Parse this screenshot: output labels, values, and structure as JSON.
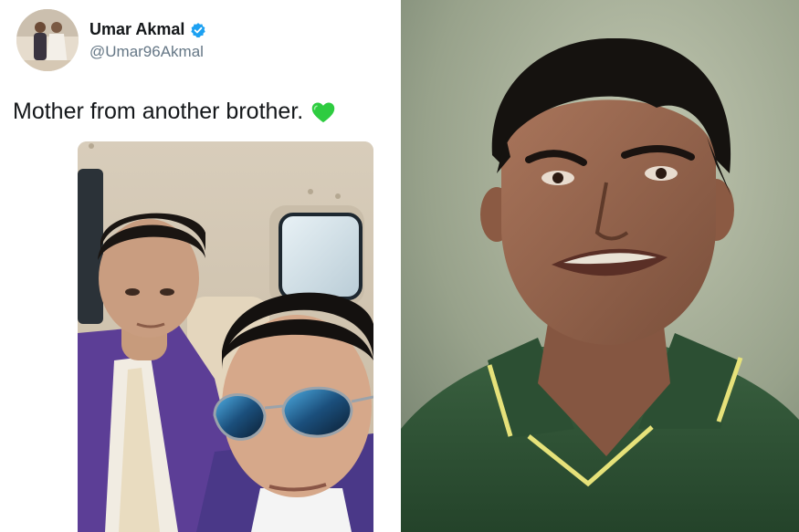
{
  "tweet": {
    "author_name": "Umar Akmal",
    "author_handle": "@Umar96Akmal",
    "text": "Mother from another brother.",
    "emoji_icon": "green-heart-icon",
    "verified_icon": "verified-badge-icon",
    "colors": {
      "name": "#14171a",
      "handle": "#657786",
      "verified": "#1da1f2",
      "heart": "#2ecc40"
    }
  },
  "right_photo": {
    "jersey_color": "#2f5232",
    "collar_stripe_color": "#e6e27a"
  }
}
